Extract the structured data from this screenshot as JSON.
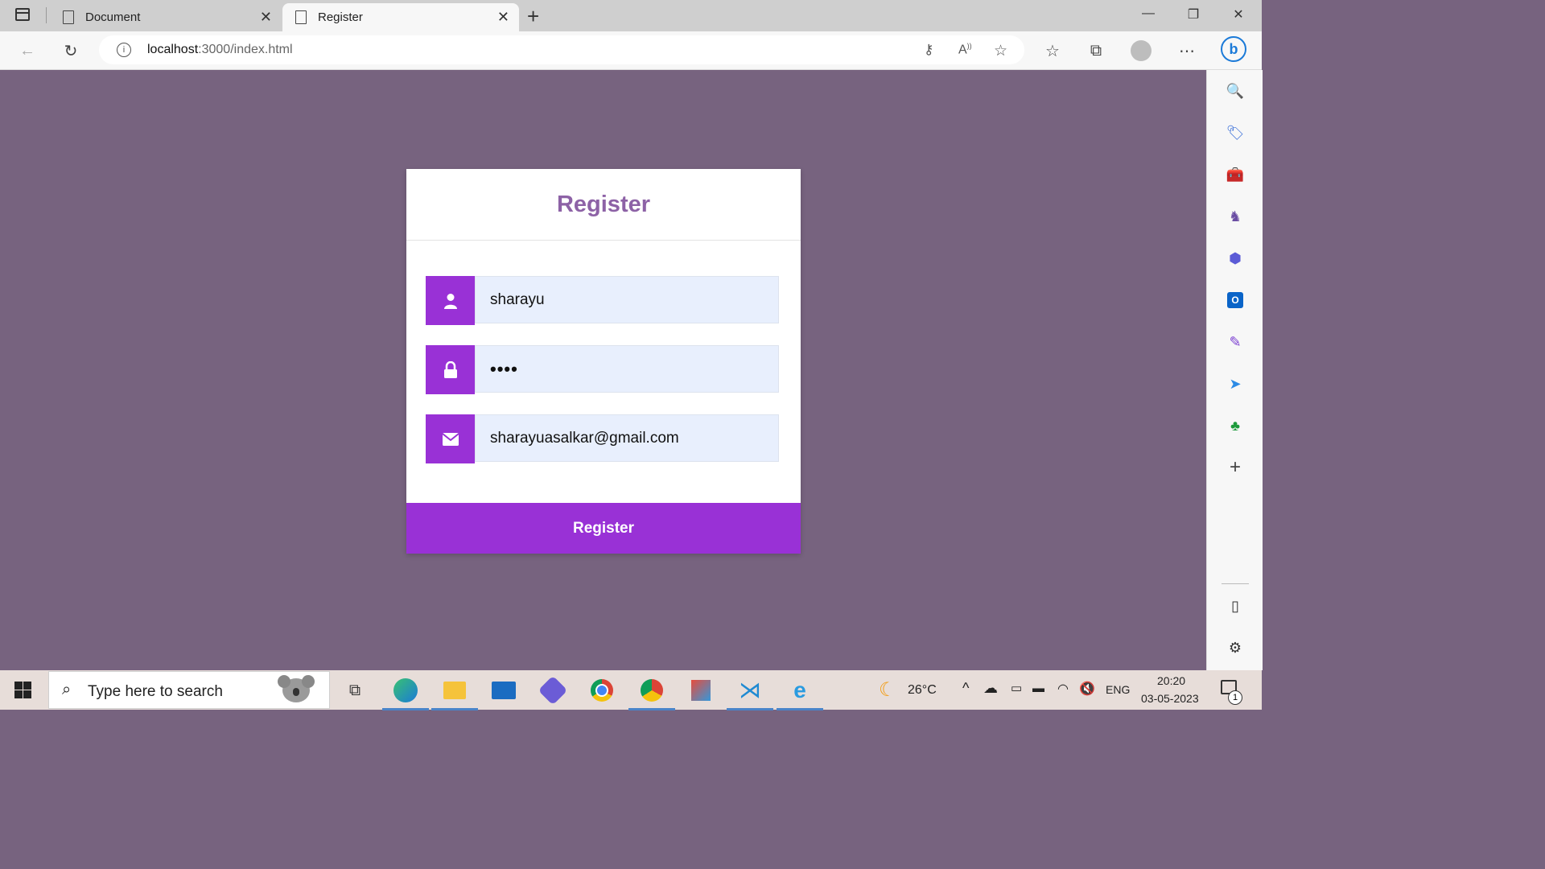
{
  "browser": {
    "tabs": [
      {
        "label": "Document",
        "active": false
      },
      {
        "label": "Register",
        "active": true
      }
    ],
    "url_host": "localhost",
    "url_path": ":3000/index.html"
  },
  "form": {
    "title": "Register",
    "username_value": "sharayu",
    "password_value": "••••",
    "email_value": "sharayuasalkar@gmail.com",
    "submit_label": "Register"
  },
  "taskbar": {
    "search_placeholder": "Type here to search",
    "weather": "26°C",
    "language": "ENG",
    "time": "20:20",
    "date": "03-05-2023",
    "notification_count": "1"
  },
  "colors": {
    "page_background": "#77637f",
    "accent": "#9931d6",
    "title": "#8d62a6",
    "input_background": "#e8effd"
  }
}
